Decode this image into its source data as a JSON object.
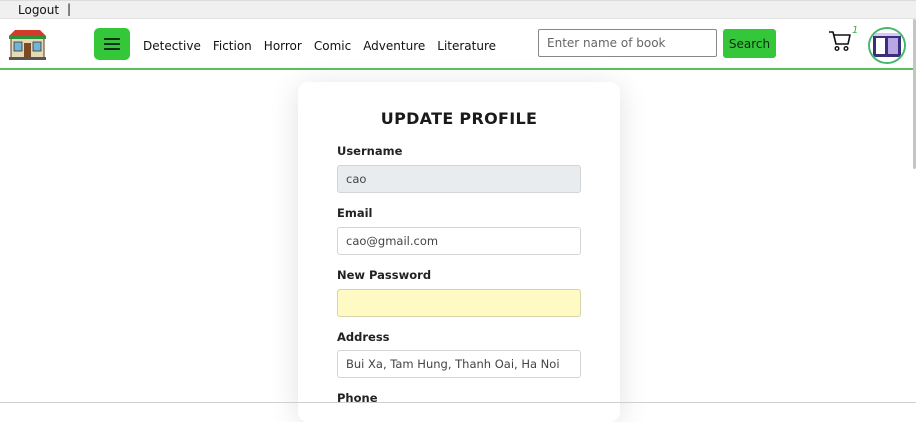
{
  "topbar": {
    "logout": "Logout",
    "separator": "|"
  },
  "navbar": {
    "categories": [
      "Detective",
      "Fiction",
      "Horror",
      "Comic",
      "Adventure",
      "Literature"
    ],
    "search": {
      "placeholder": "Enter name of book",
      "value": "",
      "button": "Search"
    },
    "cart_count": "1"
  },
  "form": {
    "title": "UPDATE PROFILE",
    "username": {
      "label": "Username",
      "value": "cao"
    },
    "email": {
      "label": "Email",
      "value": "cao@gmail.com"
    },
    "new_password": {
      "label": "New Password",
      "value": ""
    },
    "address": {
      "label": "Address",
      "value": "Bui Xa, Tam Hung, Thanh Oai, Ha Noi"
    },
    "phone": {
      "label": "Phone"
    }
  },
  "colors": {
    "accent": "#35c73a",
    "nav_border": "#5fbf5f",
    "password_fill": "#fff9c4",
    "readonly_fill": "#e9ecef"
  },
  "icons": {
    "logo": "bookstore-icon",
    "menu": "hamburger-icon",
    "cart": "cart-icon",
    "avatar": "avatar-icon"
  }
}
